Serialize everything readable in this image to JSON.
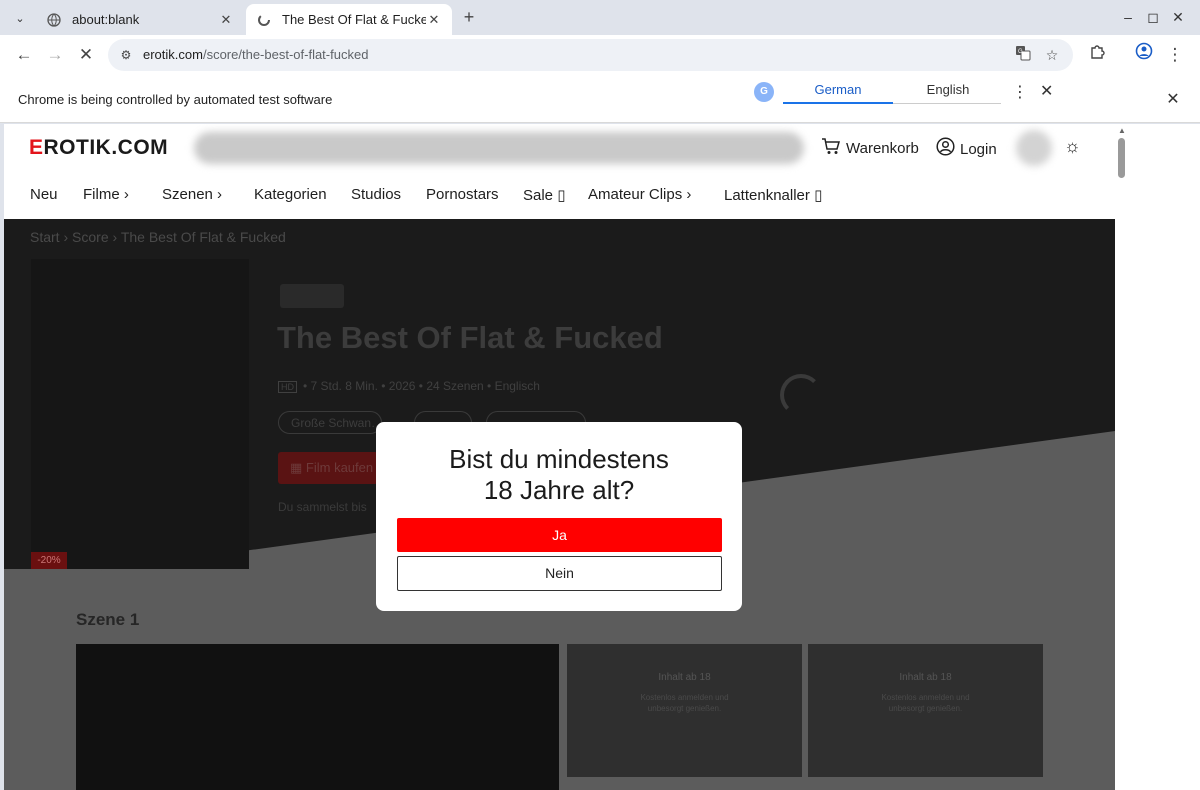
{
  "browser": {
    "tabs": [
      {
        "title": "about:blank",
        "active": false
      },
      {
        "title": "The Best Of Flat & Fucked",
        "active": true
      }
    ],
    "url_domain": "erotik.com",
    "url_path": "/score/the-best-of-flat-fucked",
    "infobar_text": "Chrome is being controlled by automated test software",
    "translate": {
      "source": "German",
      "target": "English"
    }
  },
  "site": {
    "logo_prefix": "E",
    "logo_rest": "ROTIK.COM",
    "header": {
      "cart": "Warenkorb",
      "login": "Login"
    },
    "nav": [
      "Neu",
      "Filme",
      "Szenen",
      "Kategorien",
      "Studios",
      "Pornostars",
      "Sale",
      "Amateur Clips",
      "Lattenknaller"
    ],
    "breadcrumb": [
      "Start",
      "Score",
      "The Best Of Flat & Fucked"
    ],
    "movie": {
      "title": "The Best Of Flat & Fucked",
      "hd": "HD",
      "meta": "• 7 Std. 8 Min. • 2026 • 24 Szenen • Englisch",
      "tags": [
        "Große Schwan…",
        "",
        ""
      ],
      "buy_label": "Film kaufen",
      "collect_text": "Du sammelst bis",
      "discount": "-20%"
    },
    "scene": {
      "title": "Szene 1",
      "locked_title": "Inhalt ab 18",
      "locked_sub": "Kostenlos anmelden und\nunbesorgt genießen."
    }
  },
  "age_gate": {
    "question_line1": "Bist du mindestens",
    "question_line2": "18 Jahre alt?",
    "yes": "Ja",
    "no": "Nein"
  }
}
